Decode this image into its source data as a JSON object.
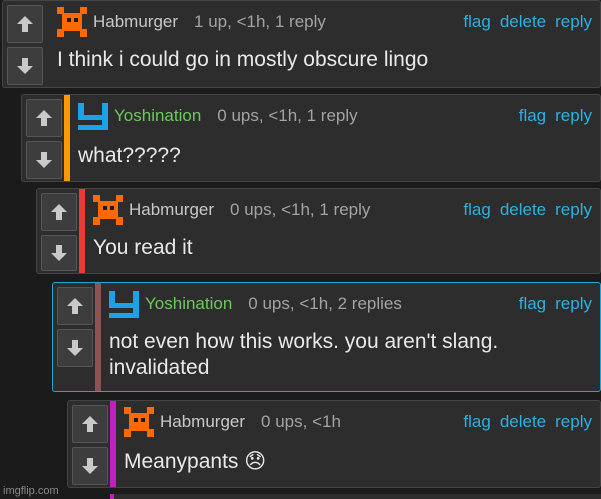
{
  "comments": [
    {
      "username": "Habmurger",
      "meta": "1 up, <1h, 1 reply",
      "actions": [
        "flag",
        "delete",
        "reply"
      ],
      "text": "I think i could go in mostly obscure lingo",
      "depth_color": "",
      "avatar": "orange-pixel-creature-icon",
      "username_color": "#c8c8c8"
    },
    {
      "username": "Yoshination",
      "meta": "0 ups, <1h, 1 reply",
      "actions": [
        "flag",
        "reply"
      ],
      "text": "what?????",
      "depth_color": "#ff9900",
      "avatar": "blue-y-icon",
      "username_color": "#6cc95b"
    },
    {
      "username": "Habmurger",
      "meta": "0 ups, <1h, 1 reply",
      "actions": [
        "flag",
        "delete",
        "reply"
      ],
      "text": "You read it",
      "depth_color": "#e83a3a",
      "avatar": "orange-pixel-creature-icon",
      "username_color": "#c8c8c8"
    },
    {
      "username": "Yoshination",
      "meta": "0 ups, <1h, 2 replies",
      "actions": [
        "flag",
        "reply"
      ],
      "text": "not even how this works. you aren't slang. invalidated",
      "depth_color": "#8a5555",
      "avatar": "blue-y-icon",
      "username_color": "#6cc95b"
    },
    {
      "username": "Habmurger",
      "meta": "0 ups, <1h",
      "actions": [
        "flag",
        "delete",
        "reply"
      ],
      "text": "Meanypants 😞",
      "depth_color": "#c21fc2",
      "avatar": "orange-pixel-creature-icon",
      "username_color": "#c8c8c8"
    }
  ],
  "watermark": "imgflip.com",
  "colors": {
    "link": "#2ab1e6",
    "background": "#1b1b1b",
    "panel": "#2d2d2d",
    "highlight_border": "#1ea7d6"
  }
}
